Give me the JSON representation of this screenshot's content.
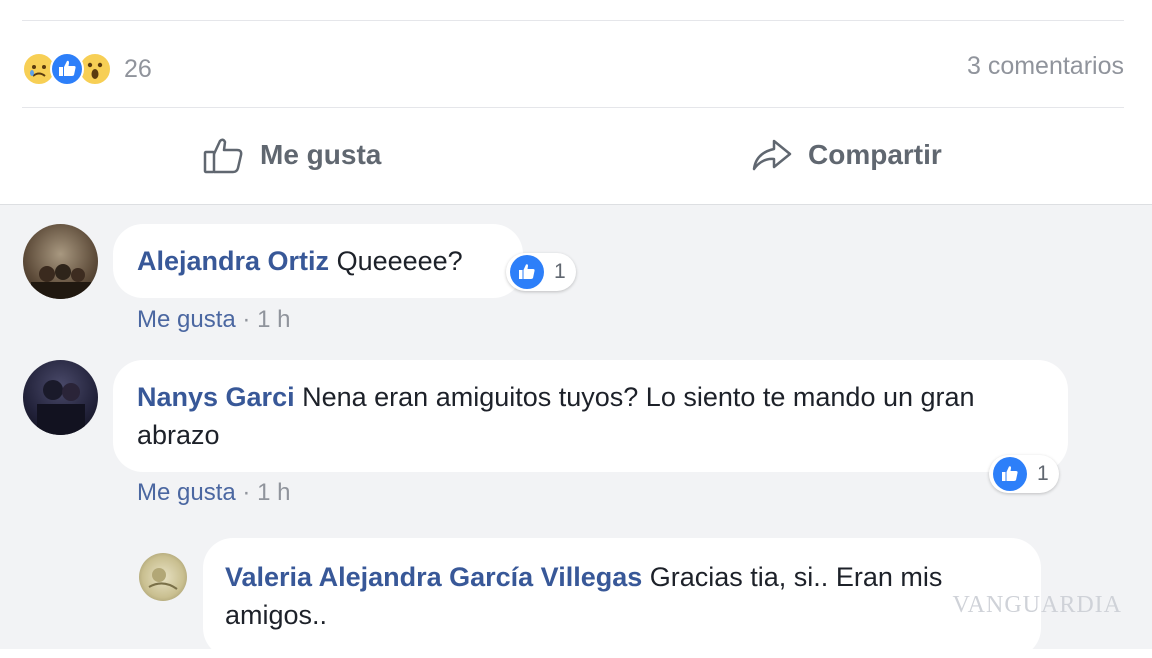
{
  "reactions": {
    "count": "26",
    "comments_label": "3 comentarios"
  },
  "actions": {
    "like_label": "Me gusta",
    "share_label": "Compartir"
  },
  "comments": [
    {
      "author": "Alejandra Ortiz",
      "text": "Queeeee?",
      "like_label": "Me gusta",
      "time": "1 h",
      "likes": "1"
    },
    {
      "author": "Nanys Garci",
      "text": "Nena eran amiguitos tuyos? Lo siento te mando un gran abrazo",
      "like_label": "Me gusta",
      "time": "1 h",
      "likes": "1"
    }
  ],
  "reply": {
    "author": "Valeria Alejandra García Villegas",
    "text": "Gracias tia, si.. Eran mis amigos.."
  },
  "colors": {
    "accent": "#385898",
    "like_blue": "#2d7ff9",
    "meta_gray": "#90949c",
    "comment_bg": "#f2f3f5"
  },
  "icons": [
    "sad-reaction-icon",
    "like-reaction-icon",
    "wow-reaction-icon",
    "thumbs-up-outline-icon",
    "share-arrow-icon"
  ],
  "watermark": "VANGUARDIA"
}
